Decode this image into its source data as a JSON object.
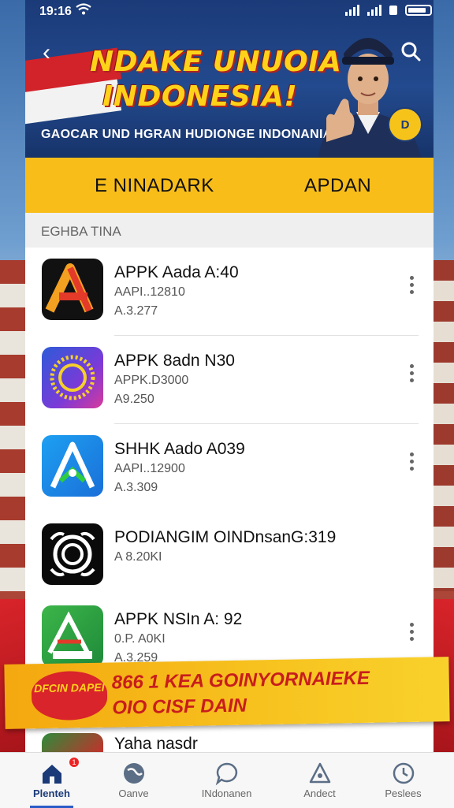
{
  "status_bar": {
    "time": "19:16",
    "wifi_icon": "wifi-icon",
    "signal_icon": "signal-icon",
    "battery_icon": "battery-icon"
  },
  "header": {
    "title_line1": "NDAKE UNUOIA",
    "title_line2": "INDONESIA!",
    "subtitle": "GAOCAR UND HGRAN HUDIONGE INDONANIA",
    "badge_text": "D",
    "colors": {
      "banner": "#1b3a78",
      "title": "#ffd21a",
      "flag_red": "#d2222a"
    }
  },
  "tabs": [
    {
      "label": "E NINADARK"
    },
    {
      "label": "APDAN"
    }
  ],
  "section": {
    "label": "EGHBA TINA"
  },
  "apps": [
    {
      "name": "APPK Aada A:40",
      "line2": "AAPI..12810",
      "line3": "A.3.277"
    },
    {
      "name": "APPK 8adn N30",
      "line2": "APPK.D3000",
      "line3": "A9.250"
    },
    {
      "name": "SHHK Aado A039",
      "line2": "AAPI..12900",
      "line3": "A.3.309"
    },
    {
      "name": "PODIANGIM OINDnsanG:319",
      "line2": "A 8.20KI",
      "line3": ""
    },
    {
      "name": "APPK NSIn A: 92",
      "line2": "0.P. A0KI",
      "line3": "A.3.259"
    }
  ],
  "promo": {
    "tag": "DFCIN DAPEI",
    "line1": "866 1 KEA GOINYORNAIEKE",
    "line2": "OIO CISF DAIN"
  },
  "partial_item": {
    "name": "Yaha nasdr"
  },
  "nav": [
    {
      "label": "Plenteh",
      "icon": "home-icon",
      "active": true,
      "badge": "1"
    },
    {
      "label": "Oanve",
      "icon": "globe-icon",
      "active": false
    },
    {
      "label": "INdonanen",
      "icon": "chat-icon",
      "active": false
    },
    {
      "label": "Andect",
      "icon": "triangle-icon",
      "active": false
    },
    {
      "label": "Peslees",
      "icon": "clock-icon",
      "active": false
    }
  ]
}
